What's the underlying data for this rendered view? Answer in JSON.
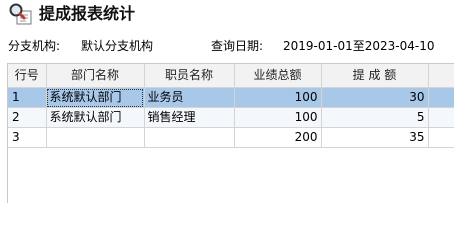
{
  "window": {
    "title": "提成报表统计"
  },
  "filters": {
    "branch_label": "分支机构:",
    "branch_value": "默认分支机构",
    "date_label": "查询日期:",
    "date_range": "2019-01-01至2023-04-10"
  },
  "table": {
    "headers": [
      "行号",
      "部门名称",
      "职员名称",
      "业绩总额",
      "提 成 额"
    ],
    "rows": [
      [
        "1",
        "系统默认部门",
        "业务员",
        "100",
        "30"
      ],
      [
        "2",
        "系统默认部门",
        "销售经理",
        "100",
        "5"
      ],
      [
        "3",
        "",
        "",
        "200",
        "35"
      ]
    ],
    "selected_row": 1
  },
  "colors": {
    "selected_row": "#a8c8ea",
    "header_bg": "#f2f2f2",
    "grid_line": "#d4d4d4"
  },
  "icons": {
    "title": "magnifier-report-icon"
  }
}
